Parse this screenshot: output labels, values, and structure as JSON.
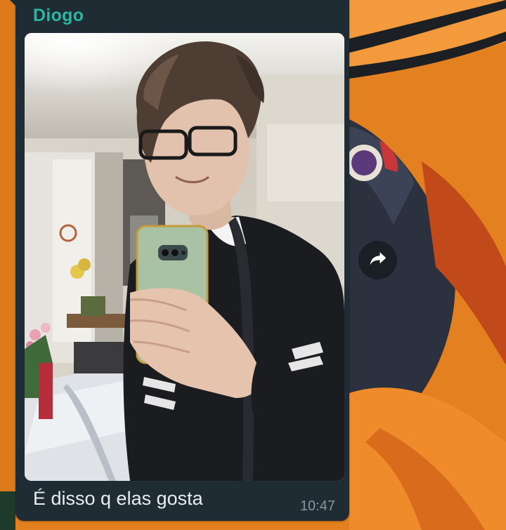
{
  "message": {
    "sender": "Diogo",
    "caption": "É disso q elas gosta",
    "time": "10:47"
  },
  "icons": {
    "forward": "forward-arrow-icon"
  },
  "colors": {
    "bubble_bg": "#1f2c34",
    "sender_name": "#29b6a3",
    "caption_text": "#e9edef",
    "timestamp_text": "#8696a0",
    "wallpaper": "#e07a1e"
  }
}
